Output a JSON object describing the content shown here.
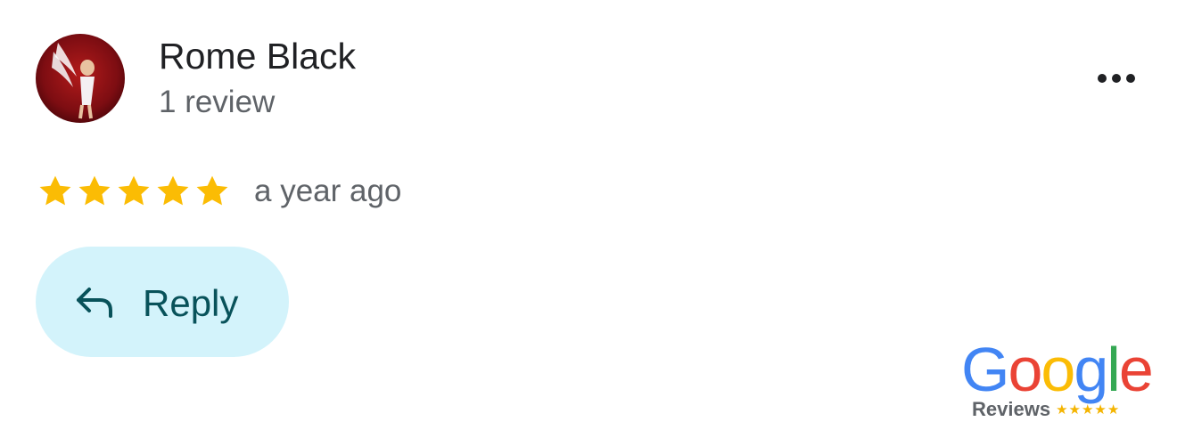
{
  "review": {
    "author": "Rome Black",
    "review_count": "1 review",
    "rating": 5,
    "max_rating": 5,
    "time": "a year ago"
  },
  "actions": {
    "reply_label": "Reply",
    "more_icon": "more-horizontal-icon"
  },
  "badge": {
    "logo_letters": [
      "G",
      "o",
      "o",
      "g",
      "l",
      "e"
    ],
    "logo_colors": [
      "#4285F4",
      "#EA4335",
      "#FBBC05",
      "#4285F4",
      "#34A853",
      "#EA4335"
    ],
    "reviews_label": "Reviews",
    "stars_text": "★★★★★"
  },
  "colors": {
    "star": "#FBBC04",
    "reply_background": "#D3F3FB",
    "reply_text": "#08525A"
  }
}
